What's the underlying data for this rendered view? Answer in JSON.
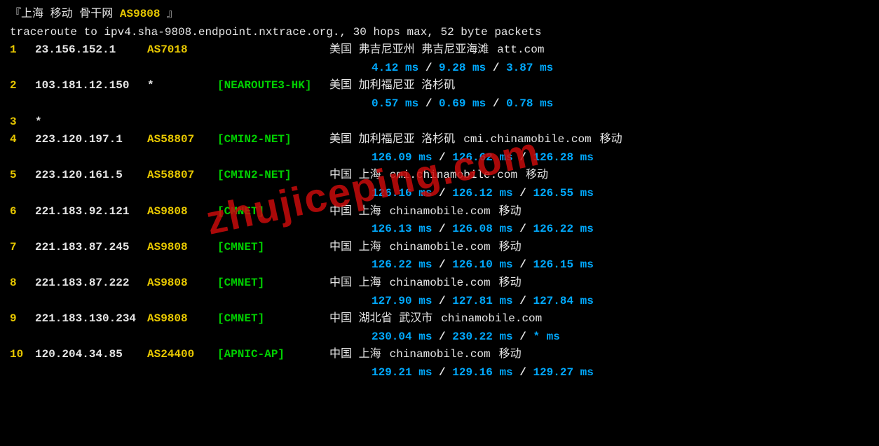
{
  "header": {
    "prefix": "『",
    "loc1": "上海",
    "loc2": "移动",
    "loc3": "骨干网",
    "asn": "AS9808",
    "suffix": "』"
  },
  "cmd": "traceroute to ipv4.sha-9808.endpoint.nxtrace.org., 30 hops max, 52 byte packets",
  "watermark": "zhujiceping.com",
  "hops": [
    {
      "n": "1",
      "ip": "23.156.152.1",
      "as": "AS7018",
      "net": "",
      "loc": "美国 弗吉尼亚州 弗吉尼亚海滩",
      "domain": "att.com",
      "tag": "",
      "lat": [
        "4.12 ms",
        "9.28 ms",
        "3.87 ms"
      ]
    },
    {
      "n": "2",
      "ip": "103.181.12.150",
      "as": "*",
      "net": "[NEAROUTE3-HK]",
      "loc": "美国 加利福尼亚 洛杉矶",
      "domain": "",
      "tag": "",
      "lat": [
        "0.57 ms",
        "0.69 ms",
        "0.78 ms"
      ]
    },
    {
      "n": "3",
      "ip": "*",
      "as": "",
      "net": "",
      "loc": "",
      "domain": "",
      "tag": "",
      "lat": null
    },
    {
      "n": "4",
      "ip": "223.120.197.1",
      "as": "AS58807",
      "net": "[CMIN2-NET]",
      "loc": "美国 加利福尼亚 洛杉矶",
      "domain": "cmi.chinamobile.com",
      "tag": "移动",
      "lat": [
        "126.09 ms",
        "126.62 ms",
        "126.28 ms"
      ]
    },
    {
      "n": "5",
      "ip": "223.120.161.5",
      "as": "AS58807",
      "net": "[CMIN2-NET]",
      "loc": "中国 上海",
      "domain": "cmi.chinamobile.com",
      "tag": "移动",
      "lat": [
        "126.16 ms",
        "126.12 ms",
        "126.55 ms"
      ]
    },
    {
      "n": "6",
      "ip": "221.183.92.121",
      "as": "AS9808",
      "net": "[CMNET]",
      "loc": "中国 上海",
      "domain": "chinamobile.com",
      "tag": "移动",
      "lat": [
        "126.13 ms",
        "126.08 ms",
        "126.22 ms"
      ]
    },
    {
      "n": "7",
      "ip": "221.183.87.245",
      "as": "AS9808",
      "net": "[CMNET]",
      "loc": "中国 上海",
      "domain": "chinamobile.com",
      "tag": "移动",
      "lat": [
        "126.22 ms",
        "126.10 ms",
        "126.15 ms"
      ]
    },
    {
      "n": "8",
      "ip": "221.183.87.222",
      "as": "AS9808",
      "net": "[CMNET]",
      "loc": "中国 上海",
      "domain": "chinamobile.com",
      "tag": "移动",
      "lat": [
        "127.90 ms",
        "127.81 ms",
        "127.84 ms"
      ]
    },
    {
      "n": "9",
      "ip": "221.183.130.234",
      "as": "AS9808",
      "net": "[CMNET]",
      "loc": "中国 湖北省 武汉市",
      "domain": "chinamobile.com",
      "tag": "",
      "lat": [
        "230.04 ms",
        "230.22 ms",
        "* ms"
      ]
    },
    {
      "n": "10",
      "ip": "120.204.34.85",
      "as": "AS24400",
      "net": "[APNIC-AP]",
      "loc": "中国 上海",
      "domain": "chinamobile.com",
      "tag": "移动",
      "lat": [
        "129.21 ms",
        "129.16 ms",
        "129.27 ms"
      ]
    }
  ]
}
